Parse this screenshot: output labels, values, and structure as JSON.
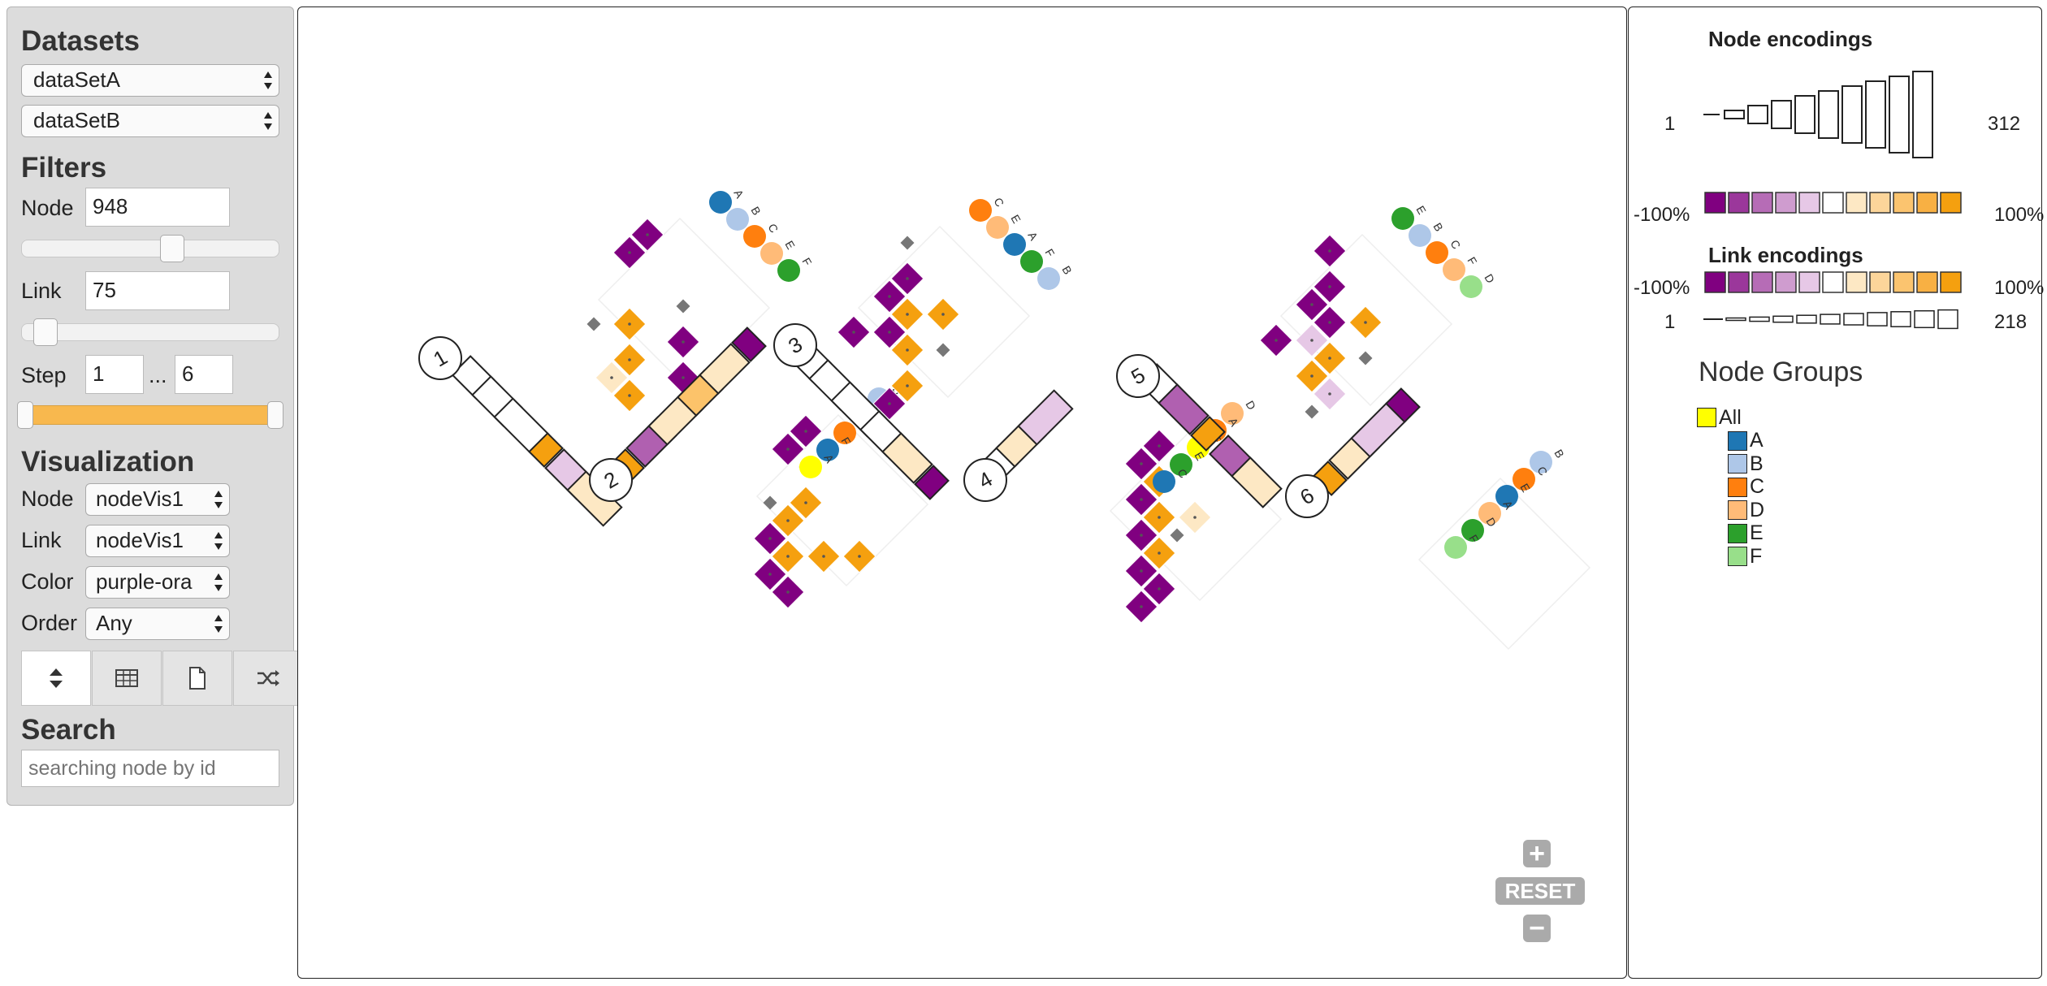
{
  "sidebar": {
    "datasets_title": "Datasets",
    "dataset_a": "dataSetA",
    "dataset_b": "dataSetB",
    "filters_title": "Filters",
    "node_label": "Node",
    "node_value": "948",
    "node_slider_level": 0.59,
    "link_label": "Link",
    "link_value": "75",
    "link_slider_level": 0.05,
    "step_label": "Step",
    "step_from": "1",
    "step_sep": "...",
    "step_to": "6",
    "visualization_title": "Visualization",
    "vis_node_label": "Node",
    "vis_node_value": "nodeVis1",
    "vis_link_label": "Link",
    "vis_link_value": "nodeVis1",
    "vis_color_label": "Color",
    "vis_color_value": "purple-ora",
    "vis_order_label": "Order",
    "vis_order_value": "Any",
    "tool_buttons": [
      "sort-icon",
      "table-icon",
      "document-icon",
      "shuffle-icon"
    ],
    "search_title": "Search",
    "search_placeholder": "searching node by id"
  },
  "canvas": {
    "steps": [
      "1",
      "2",
      "3",
      "4",
      "5",
      "6"
    ],
    "group_letters": [
      "A",
      "B",
      "C",
      "D",
      "E",
      "F"
    ],
    "zoom_reset": "RESET",
    "colors": {
      "purple_dark": "#800080",
      "purple_mid": "#b060b0",
      "purple_light": "#e6c8e6",
      "neutral": "#ffffff",
      "orange_light": "#fde8c4",
      "orange_mid": "#fcc36a",
      "orange_dark": "#f5a00f"
    }
  },
  "legend": {
    "node_encodings_title": "Node encodings",
    "node_size_min": "1",
    "node_size_max": "312",
    "node_color_min": "-100%",
    "node_color_max": "100%",
    "link_encodings_title": "Link encodings",
    "link_color_min": "-100%",
    "link_color_max": "100%",
    "link_width_min": "1",
    "link_width_max": "218",
    "node_groups_title": "Node Groups",
    "groups": [
      {
        "label": "All",
        "color": "#ffff00"
      },
      {
        "label": "A",
        "color": "#1f77b4"
      },
      {
        "label": "B",
        "color": "#aec7e8"
      },
      {
        "label": "C",
        "color": "#ff7f0e"
      },
      {
        "label": "D",
        "color": "#ffbb78"
      },
      {
        "label": "E",
        "color": "#2ca02c"
      },
      {
        "label": "F",
        "color": "#98df8a"
      }
    ],
    "scale_colors": [
      "#800080",
      "#9b379b",
      "#b66cb6",
      "#cf9ccf",
      "#e6c8e6",
      "#ffffff",
      "#fde8c4",
      "#fcd59a",
      "#fbc46f",
      "#f8b043",
      "#f5a00f"
    ]
  }
}
